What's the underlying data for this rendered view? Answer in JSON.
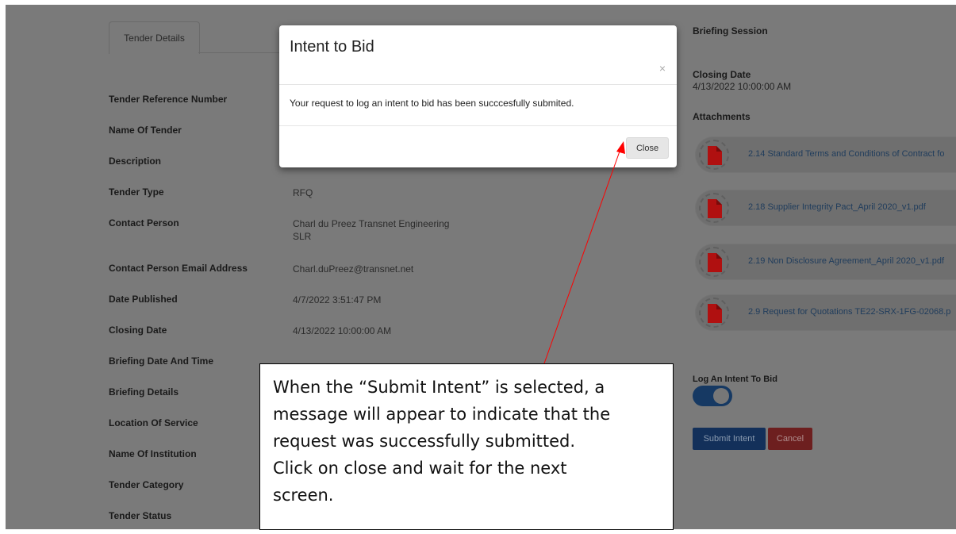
{
  "tab": {
    "label": "Tender Details"
  },
  "fields": [
    {
      "label": "Tender Reference Number",
      "value": ""
    },
    {
      "label": "Name Of Tender",
      "value": ""
    },
    {
      "label": "Description",
      "value": ""
    },
    {
      "label": "Tender Type",
      "value": "RFQ"
    },
    {
      "label": "Contact Person",
      "value": "Charl du Preez Transnet Engineering",
      "value2": "SLR"
    },
    {
      "label": "Contact Person Email Address",
      "value": "Charl.duPreez@transnet.net"
    },
    {
      "label": "Date Published",
      "value": "4/7/2022 3:51:47 PM"
    },
    {
      "label": "Closing Date",
      "value": "4/13/2022 10:00:00 AM"
    },
    {
      "label": "Briefing Date And Time",
      "value": ""
    },
    {
      "label": "Briefing Details",
      "value": ""
    },
    {
      "label": "Location Of Service",
      "value": ""
    },
    {
      "label": "Name Of Institution",
      "value": ""
    },
    {
      "label": "Tender Category",
      "value": ""
    },
    {
      "label": "Tender Status",
      "value": ""
    }
  ],
  "right": {
    "briefing_heading": "Briefing Session",
    "closing_heading": "Closing Date",
    "closing_value": "4/13/2022 10:00:00 AM",
    "attachments_heading": "Attachments",
    "attachments": [
      "2.14 Standard Terms and Conditions of Contract fo",
      "2.18 Supplier Integrity Pact_April 2020_v1.pdf",
      "2.19 Non Disclosure Agreement_April 2020_v1.pdf",
      "2.9 Request for Quotations TE22-SRX-1FG-02068.p"
    ],
    "intent_label": "Log An Intent To Bid",
    "intent_toggle_on": true,
    "submit_label": "Submit Intent",
    "cancel_label": "Cancel"
  },
  "modal": {
    "title": "Intent to Bid",
    "close_x": "×",
    "message": "Your request to log an intent to bid has been succcesfully submited.",
    "close_button": "Close"
  },
  "callout": {
    "lines": [
      "When the “Submit Intent” is selected, a",
      "message will appear to indicate that the",
      "request was successfully submitted.",
      "Click on close and wait for the next",
      "screen."
    ]
  },
  "colors": {
    "pdf_icon": "#b01010",
    "annotation_arrow": "#ff0000",
    "submit_bg": "#13305a",
    "cancel_bg": "#6d1f1f"
  }
}
